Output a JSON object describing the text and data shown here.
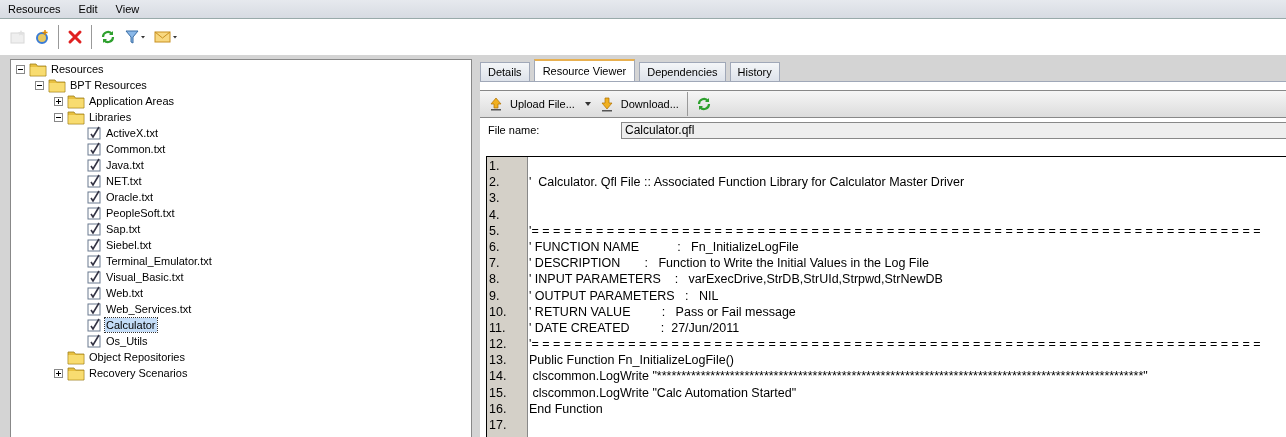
{
  "menu": [
    "Resources",
    "Edit",
    "View"
  ],
  "toolbar": [
    {
      "kind": "new",
      "disabled": true
    },
    {
      "kind": "add",
      "disabled": false
    },
    {
      "kind": "sep"
    },
    {
      "kind": "delete",
      "disabled": false
    },
    {
      "kind": "sep"
    },
    {
      "kind": "refresh",
      "disabled": false
    },
    {
      "kind": "filter",
      "disabled": false
    },
    {
      "kind": "mail",
      "disabled": false
    }
  ],
  "tree": [
    {
      "label": "Resources",
      "kind": "folder",
      "expanded": true,
      "selected": false,
      "children": [
        {
          "label": "BPT Resources",
          "kind": "folder",
          "expanded": true,
          "selected": false,
          "children": [
            {
              "label": "Application Areas",
              "kind": "folder",
              "expanded": false,
              "selected": false
            },
            {
              "label": "Libraries",
              "kind": "folder",
              "expanded": true,
              "selected": false,
              "children": [
                {
                  "label": "ActiveX.txt",
                  "kind": "file",
                  "selected": false
                },
                {
                  "label": "Common.txt",
                  "kind": "file",
                  "selected": false
                },
                {
                  "label": "Java.txt",
                  "kind": "file",
                  "selected": false
                },
                {
                  "label": "NET.txt",
                  "kind": "file",
                  "selected": false
                },
                {
                  "label": "Oracle.txt",
                  "kind": "file",
                  "selected": false
                },
                {
                  "label": "PeopleSoft.txt",
                  "kind": "file",
                  "selected": false
                },
                {
                  "label": "Sap.txt",
                  "kind": "file",
                  "selected": false
                },
                {
                  "label": "Siebel.txt",
                  "kind": "file",
                  "selected": false
                },
                {
                  "label": "Terminal_Emulator.txt",
                  "kind": "file",
                  "selected": false
                },
                {
                  "label": "Visual_Basic.txt",
                  "kind": "file",
                  "selected": false
                },
                {
                  "label": "Web.txt",
                  "kind": "file",
                  "selected": false
                },
                {
                  "label": "Web_Services.txt",
                  "kind": "file",
                  "selected": false
                },
                {
                  "label": "Calculator",
                  "kind": "file",
                  "selected": true
                },
                {
                  "label": "Os_Utils",
                  "kind": "file",
                  "selected": false
                }
              ]
            },
            {
              "label": "Object Repositories",
              "kind": "folder",
              "selected": false
            },
            {
              "label": "Recovery Scenarios",
              "kind": "folder",
              "expanded": false,
              "selected": false
            }
          ]
        }
      ]
    }
  ],
  "tabs": [
    {
      "label": "Details",
      "selected": false
    },
    {
      "label": "Resource Viewer",
      "selected": true
    },
    {
      "label": "Dependencies",
      "selected": false
    },
    {
      "label": "History",
      "selected": false
    }
  ],
  "viewer_toolbar": [
    {
      "kind": "upload",
      "label": "Upload File..."
    },
    {
      "kind": "download",
      "label": "Download..."
    },
    {
      "kind": "refresh"
    }
  ],
  "file_name": {
    "label": "File name:",
    "value": "Calculator.qfl"
  },
  "code_lines": [
    {
      "number": "1."
    },
    {
      "number": "2.",
      "text": "'  Calculator. Qfl File :: Associated Function Library for Calculator Master Driver"
    },
    {
      "number": "3."
    },
    {
      "number": "4."
    },
    {
      "number": "5.",
      "text": "'= = = = = = = = = = = = = = = = = = = = = = = = = = = = = = = = = = = = = = = = = = = = = = = = = = = = = = = = = = = = = = = = = = = ="
    },
    {
      "number": "6.",
      "text": "' FUNCTION NAME           :   Fn_InitializeLogFile"
    },
    {
      "number": "7.",
      "text": "' DESCRIPTION       :   Function to Write the Initial Values in the Log File"
    },
    {
      "number": "8.",
      "text": "' INPUT PARAMETERS    :   varExecDrive,StrDB,StrUId,Strpwd,StrNewDB"
    },
    {
      "number": "9.",
      "text": "' OUTPUT PARAMETERS   :   NIL"
    },
    {
      "number": "10.",
      "text": "' RETURN VALUE         :   Pass or Fail message"
    },
    {
      "number": "11.",
      "text": "' DATE CREATED         :  27/Jun/2011"
    },
    {
      "number": "12.",
      "text": "'= = = = = = = = = = = = = = = = = = = = = = = = = = = = = = = = = = = = = = = = = = = = = = = = = = = = = = = = = = = = = = = = = = = ="
    },
    {
      "number": "13.",
      "text": "Public Function Fn_InitializeLogFile()"
    },
    {
      "number": "14.",
      "text": " clscommon.LogWrite \"****************************************************************************************************\""
    },
    {
      "number": "15.",
      "text": " clscommon.LogWrite \"Calc Automation Started\""
    },
    {
      "number": "16.",
      "text": "End Function"
    },
    {
      "number": "17."
    }
  ]
}
